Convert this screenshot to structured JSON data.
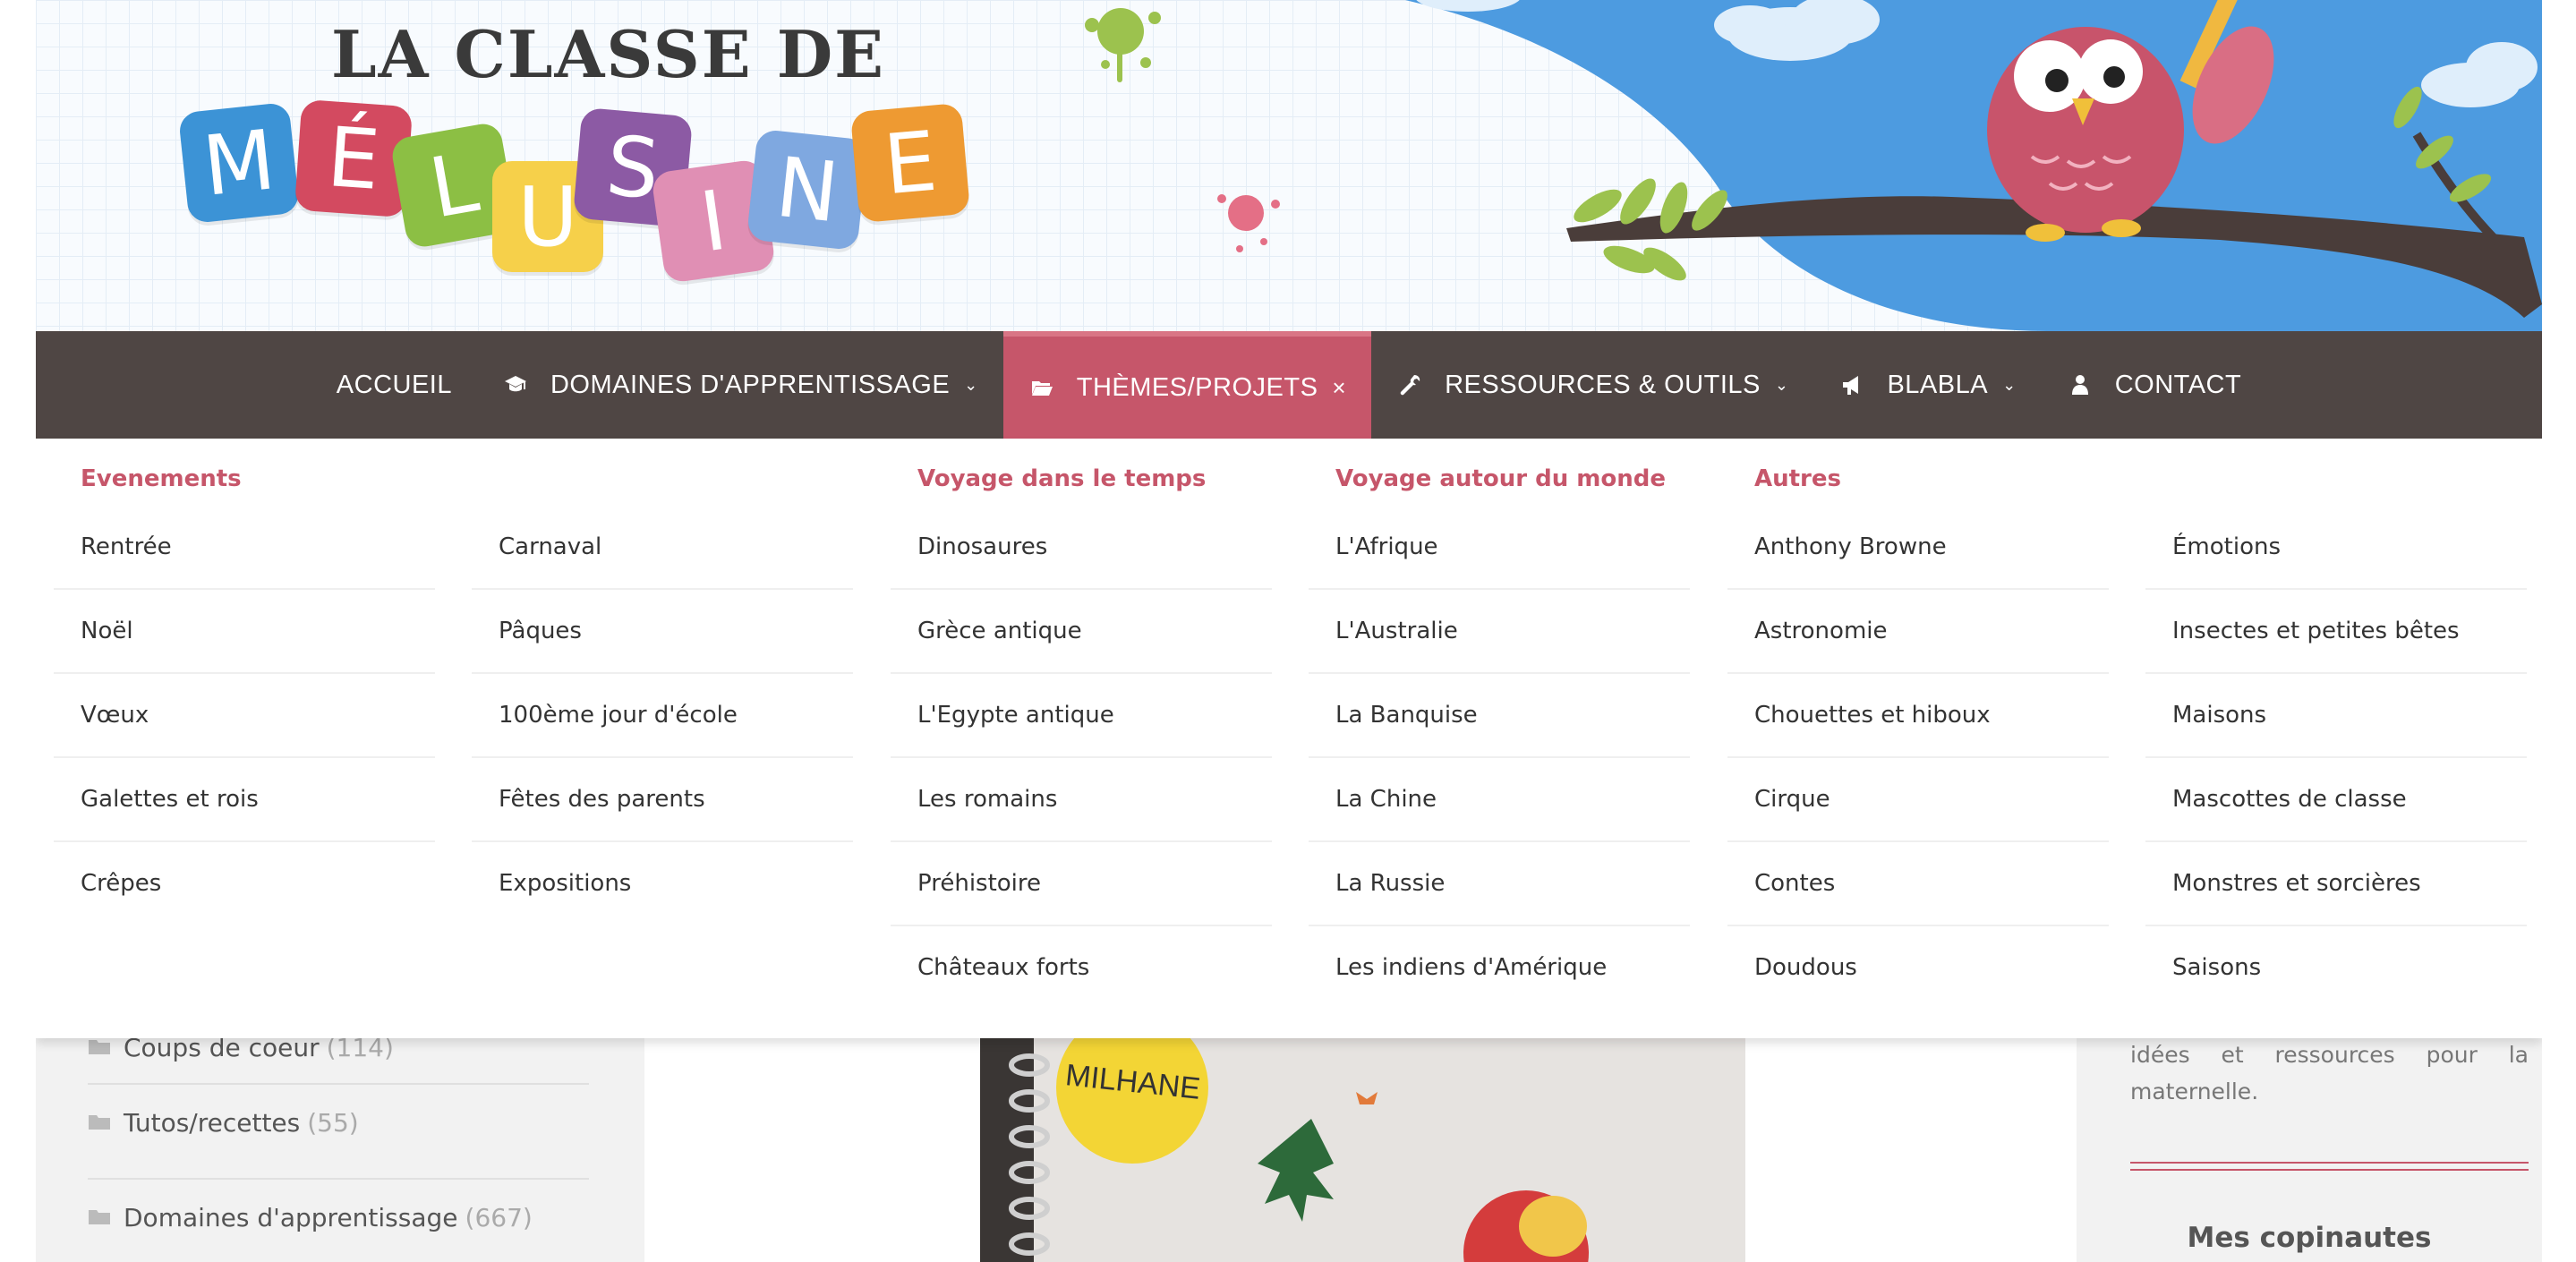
{
  "header": {
    "title_top": "LA CLASSE DE",
    "title_letters": [
      "M",
      "É",
      "L",
      "U",
      "S",
      "I",
      "N",
      "E"
    ],
    "tile_colors": [
      "#3c93d6",
      "#d34a60",
      "#8cbf44",
      "#f6d04a",
      "#8c5aa4",
      "#e08fb4",
      "#7fa8e0",
      "#ee9a32"
    ]
  },
  "nav": {
    "items": [
      {
        "label": "ACCUEIL",
        "icon": "",
        "caret": ""
      },
      {
        "label": "DOMAINES D'APPRENTISSAGE",
        "icon": "graduation-cap-icon",
        "caret": "⌄"
      },
      {
        "label": "THÈMES/PROJETS",
        "icon": "folder-open-icon",
        "caret": "×"
      },
      {
        "label": "RESSOURCES & OUTILS",
        "icon": "wrench-icon",
        "caret": "⌄"
      },
      {
        "label": "BLABLA",
        "icon": "bullhorn-icon",
        "caret": "⌄"
      },
      {
        "label": "CONTACT",
        "icon": "user-icon",
        "caret": ""
      }
    ],
    "active_color": "#c6566a",
    "bar_color": "#4f4644"
  },
  "mega_menu": {
    "headings": [
      "Evenements",
      "Voyage dans le temps",
      "Voyage autour du monde",
      "Autres"
    ],
    "columns": [
      [
        "Rentrée",
        "Noël",
        "Vœux",
        "Galettes et rois",
        "Crêpes"
      ],
      [
        "Carnaval",
        "Pâques",
        "100ème jour d'école",
        "Fêtes des parents",
        "Expositions"
      ],
      [
        "Dinosaures",
        "Grèce antique",
        "L'Egypte antique",
        "Les romains",
        "Préhistoire",
        "Châteaux forts"
      ],
      [
        "L'Afrique",
        "L'Australie",
        "La Banquise",
        "La Chine",
        "La Russie",
        "Les indiens d'Amérique"
      ],
      [
        "Anthony Browne",
        "Astronomie",
        "Chouettes et hiboux",
        "Cirque",
        "Contes",
        "Doudous"
      ],
      [
        "Émotions",
        "Insectes et petites bêtes",
        "Maisons",
        "Mascottes de classe",
        "Monstres et sorcières",
        "Saisons"
      ]
    ],
    "heading_color": "#c6566a"
  },
  "sidebar_categories": [
    {
      "label": "Coups de coeur",
      "count": "(114)"
    },
    {
      "label": "Tutos/recettes",
      "count": "(55)"
    },
    {
      "label": "Domaines d'apprentissage",
      "count": "(667)"
    }
  ],
  "photo": {
    "label": "MILHANE"
  },
  "right_sidebar": {
    "text": "idées et ressources pour la maternelle.",
    "heading": "Mes copinautes"
  }
}
